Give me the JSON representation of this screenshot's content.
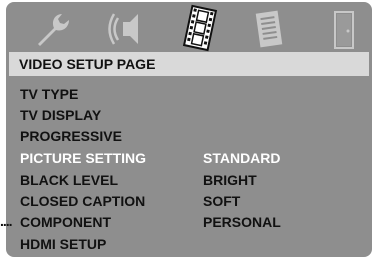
{
  "header": {
    "title": "VIDEO SETUP PAGE"
  },
  "icons": [
    {
      "name": "general-setup-wrench-icon"
    },
    {
      "name": "audio-setup-speaker-icon"
    },
    {
      "name": "video-setup-film-icon",
      "selected": true
    },
    {
      "name": "preference-page-icon"
    },
    {
      "name": "exit-door-icon"
    }
  ],
  "menu": {
    "items": [
      {
        "label": "TV TYPE"
      },
      {
        "label": "TV DISPLAY"
      },
      {
        "label": "PROGRESSIVE"
      },
      {
        "label": "PICTURE SETTING",
        "highlighted": true
      },
      {
        "label": "BLACK LEVEL"
      },
      {
        "label": "CLOSED CAPTION"
      },
      {
        "label": "COMPONENT"
      },
      {
        "label": "HDMI SETUP"
      }
    ],
    "options": [
      {
        "label": "STANDARD",
        "highlighted": true
      },
      {
        "label": "BRIGHT"
      },
      {
        "label": "SOFT"
      },
      {
        "label": "PERSONAL"
      }
    ]
  },
  "pointer": {
    "text": "...."
  },
  "colors": {
    "panel": "#8e8e8e",
    "header": "#d9d9d9",
    "highlight": "#ffffff",
    "text": "#111111"
  }
}
